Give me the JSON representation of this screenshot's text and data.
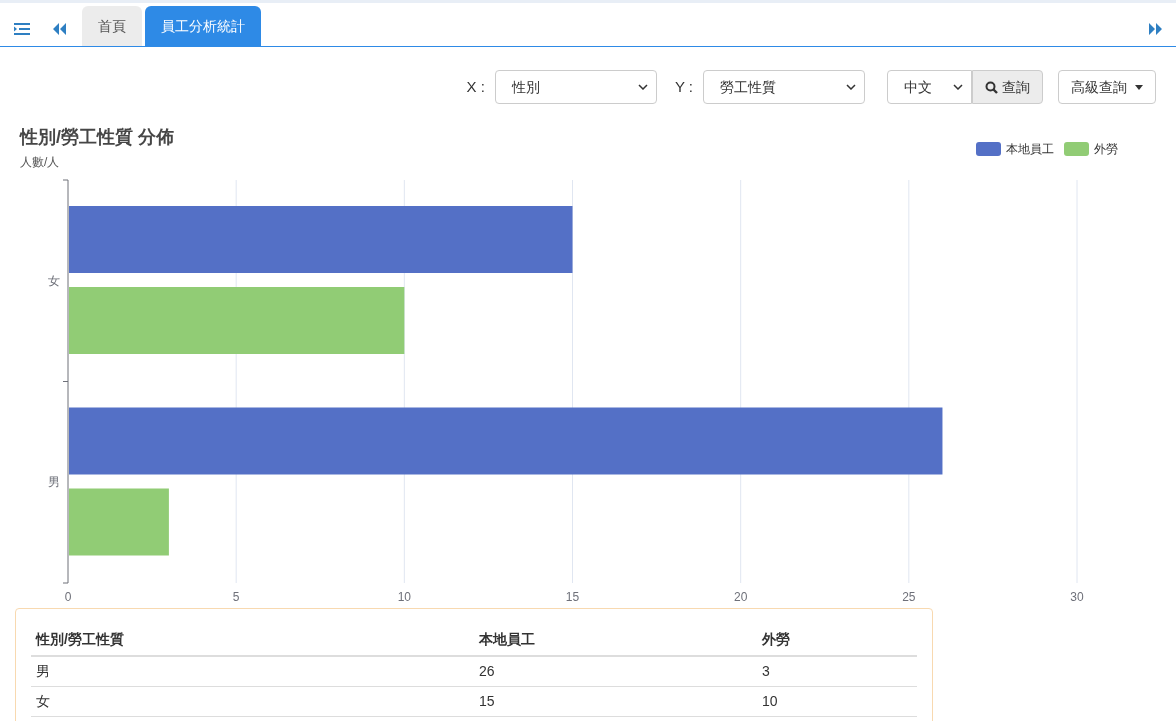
{
  "tabs": [
    {
      "label": "首頁",
      "selected": false
    },
    {
      "label": "員工分析統計",
      "selected": true
    }
  ],
  "filters": [
    {
      "label": "X :",
      "value": "性別"
    },
    {
      "label": "Y :",
      "value": "勞工性質"
    }
  ],
  "language": {
    "value": "中文"
  },
  "query_button": "查詢",
  "advanced_button": "高級查詢",
  "chart": {
    "chart_data": {
      "type": "bar",
      "orientation": "horizontal",
      "title": "性別/勞工性質 分佈",
      "ylabel": "人數/人",
      "categories": [
        "女",
        "男"
      ],
      "series": [
        {
          "name": "本地員工",
          "color": "#5470c6",
          "values": [
            15,
            26
          ]
        },
        {
          "name": "外勞",
          "color": "#91cc75",
          "values": [
            10,
            3
          ]
        }
      ],
      "xlim": [
        0,
        30
      ],
      "grid": true,
      "xticks": [
        0,
        5,
        10,
        15,
        20,
        25,
        30
      ]
    }
  },
  "table": {
    "columns": [
      "性別/勞工性質",
      "本地員工",
      "外勞"
    ],
    "rows": [
      [
        "男",
        "26",
        "3"
      ],
      [
        "女",
        "15",
        "10"
      ]
    ]
  }
}
